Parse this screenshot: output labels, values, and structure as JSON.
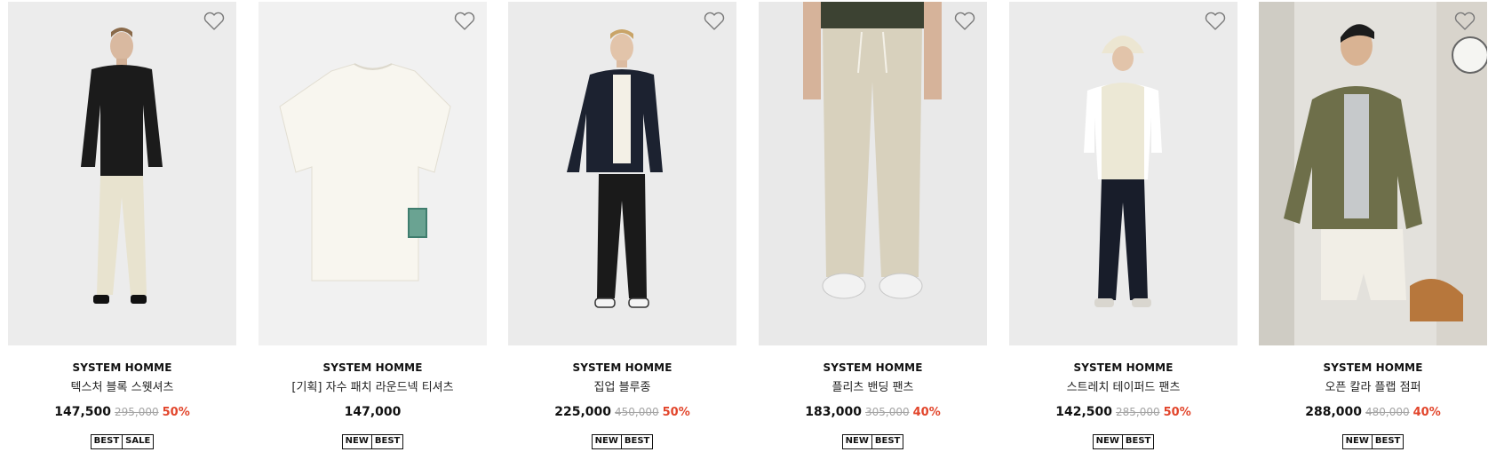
{
  "products": [
    {
      "brand": "SYSTEM HOMME",
      "name": "텍스처 블록 스웻셔츠",
      "price": "147,500",
      "original_price": "295,000",
      "discount": "50%",
      "tags": [
        "BEST",
        "SALE"
      ],
      "bg": "#ededed"
    },
    {
      "brand": "SYSTEM HOMME",
      "name": "[기획] 자수 패치 라운드넥 티셔츠",
      "price": "147,000",
      "original_price": "",
      "discount": "",
      "tags": [
        "NEW",
        "BEST"
      ],
      "bg": "#f2f2f2"
    },
    {
      "brand": "SYSTEM HOMME",
      "name": "집업 블루종",
      "price": "225,000",
      "original_price": "450,000",
      "discount": "50%",
      "tags": [
        "NEW",
        "BEST"
      ],
      "bg": "#ededed"
    },
    {
      "brand": "SYSTEM HOMME",
      "name": "플리츠 밴딩 팬츠",
      "price": "183,000",
      "original_price": "305,000",
      "discount": "40%",
      "tags": [
        "NEW",
        "BEST"
      ],
      "bg": "#ebebeb"
    },
    {
      "brand": "SYSTEM HOMME",
      "name": "스트레치 테이퍼드 팬츠",
      "price": "142,500",
      "original_price": "285,000",
      "discount": "50%",
      "tags": [
        "NEW",
        "BEST"
      ],
      "bg": "#ececec"
    },
    {
      "brand": "SYSTEM HOMME",
      "name": "오픈 칼라 플랩 점퍼",
      "price": "288,000",
      "original_price": "480,000",
      "discount": "40%",
      "tags": [
        "NEW",
        "BEST"
      ],
      "bg": "#e4e2dd"
    }
  ],
  "icons": {
    "wishlist": "heart-outline-icon"
  },
  "colors": {
    "discount": "#e2452b",
    "original_price": "#a4a4a4",
    "text": "#111111"
  }
}
